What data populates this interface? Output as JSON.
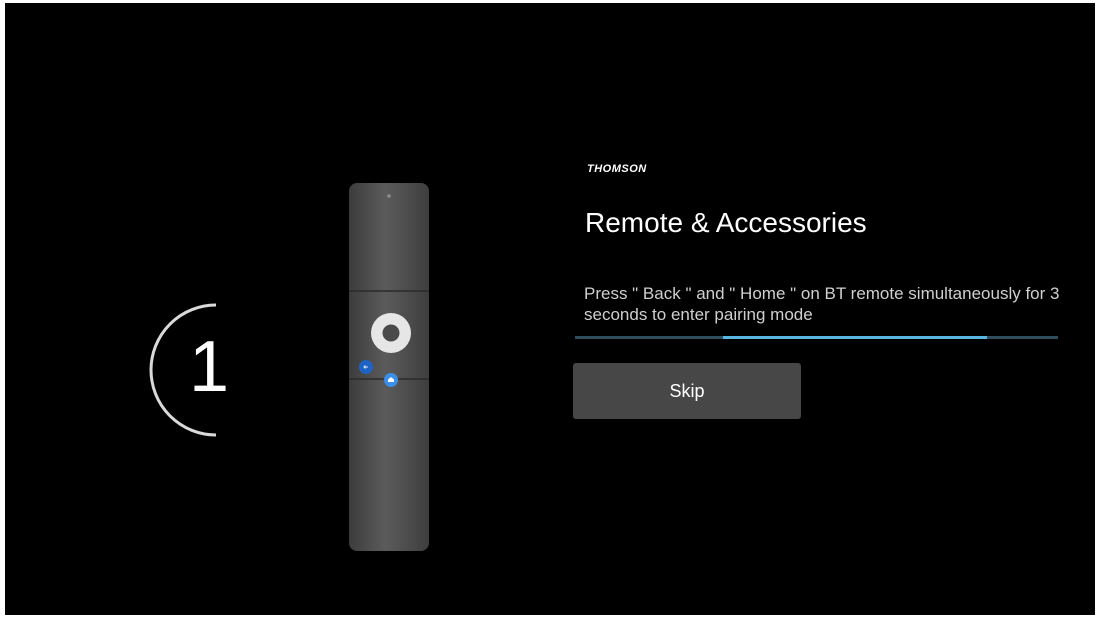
{
  "countdown": {
    "value": "1"
  },
  "brand": {
    "logo_text": "THOMSON"
  },
  "dialog": {
    "title": "Remote & Accessories",
    "instruction": "Press \" Back \" and \" Home \" on BT remote simultaneously for 3 seconds to enter pairing mode"
  },
  "skip_button": {
    "label": "Skip"
  },
  "icons": {
    "remote": "remote-control-icon",
    "back_button": "back-button-icon",
    "home_button": "home-button-icon"
  },
  "colors": {
    "background": "#000000",
    "accent": "#58b6e3",
    "button_back": "#1e63c4",
    "button_home": "#3b8fe8",
    "skip_button_bg": "#474747"
  }
}
